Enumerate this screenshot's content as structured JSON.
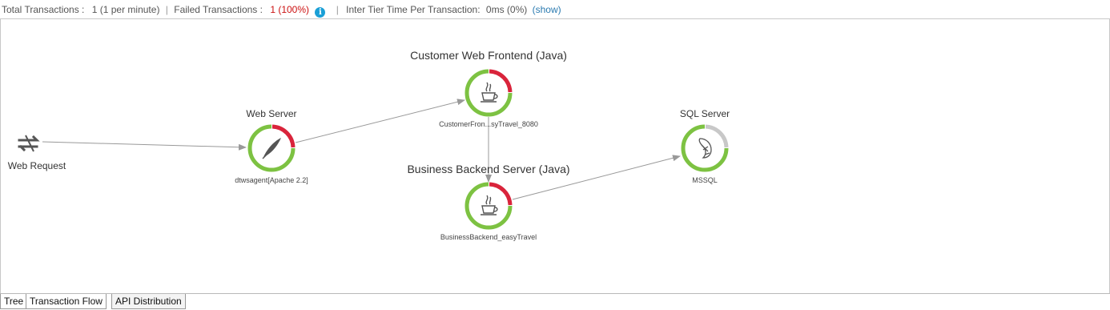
{
  "stats": {
    "total_label": "Total Transactions :",
    "total_value": "1 (1 per minute)",
    "failed_label": "Failed Transactions :",
    "failed_value": "1 (100%)",
    "info_glyph": "i",
    "inter_tier_label": "Inter Tier Time Per Transaction:",
    "inter_tier_value": "0ms (0%)",
    "show_link": "(show)"
  },
  "flow": {
    "web_request": {
      "label": "Web Request",
      "icon": "transfer-arrows-icon"
    },
    "web_server": {
      "title": "Web Server",
      "agent": "dtwsagent[Apache 2.2]",
      "icon": "apache-feather-icon",
      "ok_fraction": 0.75,
      "error_fraction": 0.25
    },
    "frontend": {
      "title": "Customer Web Frontend (Java)",
      "agent": "CustomerFron...syTravel_8080",
      "icon": "java-cup-icon",
      "ok_fraction": 0.75,
      "error_fraction": 0.25
    },
    "backend": {
      "title": "Business Backend Server (Java)",
      "agent": "BusinessBackend_easyTravel",
      "icon": "java-cup-icon",
      "ok_fraction": 0.75,
      "error_fraction": 0.25
    },
    "sql_server": {
      "title": "SQL Server",
      "agent": "MSSQL",
      "icon": "mssql-dolphin-icon",
      "ok_fraction": 0.75,
      "neutral_fraction": 0.25
    }
  },
  "colors": {
    "ok": "#7dc242",
    "error": "#d9243b",
    "neutral": "#c8c8c8",
    "edge": "#999999",
    "link": "#2a7ab0"
  },
  "tabs": [
    {
      "label": "Tree",
      "active": false
    },
    {
      "label": "Transaction Flow",
      "active": true
    },
    {
      "label": "API Distribution",
      "active": false
    }
  ]
}
